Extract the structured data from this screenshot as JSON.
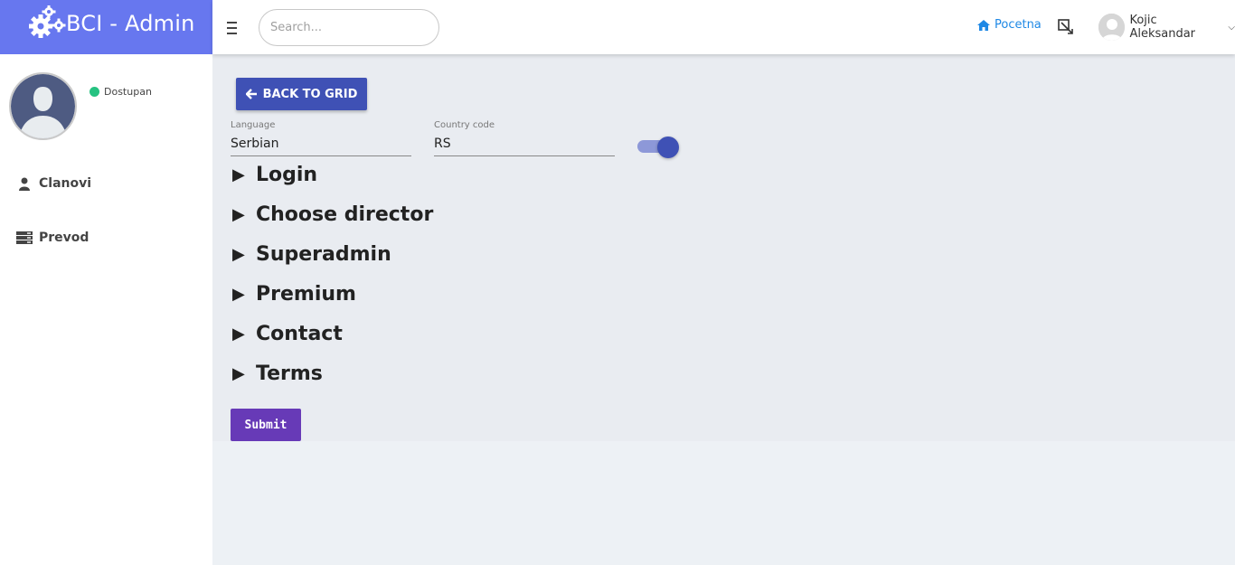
{
  "app": {
    "brand_title": "BCI - Admin",
    "brand_color": "#6777ef"
  },
  "topbar": {
    "search_placeholder": "Search...",
    "home_label": "Pocetna",
    "user_name": "Kojic Aleksandar",
    "icons": {
      "menu": "hamburger-icon",
      "home": "home-icon",
      "fullscreen": "expand-icon",
      "user_dropdown": "chevron-down-icon"
    }
  },
  "sidebar": {
    "status_label": "Dostupan",
    "status_color": "#26c281",
    "items": [
      {
        "label": "Clanovi",
        "icon": "user-icon"
      },
      {
        "label": "Prevod",
        "icon": "server-icon"
      }
    ]
  },
  "main": {
    "back_button_label": "BACK TO GRID",
    "language": {
      "label": "Language",
      "value": "Serbian"
    },
    "country_code": {
      "label": "Country code",
      "value": "RS"
    },
    "toggle": {
      "state": "on",
      "color": "#3f51b5"
    },
    "sections": [
      {
        "label": "Login"
      },
      {
        "label": "Choose director"
      },
      {
        "label": "Superadmin"
      },
      {
        "label": "Premium"
      },
      {
        "label": "Contact"
      },
      {
        "label": "Terms"
      }
    ],
    "submit_label": "Submit",
    "primary_color": "#3f51b5",
    "submit_color": "#673ab7"
  }
}
